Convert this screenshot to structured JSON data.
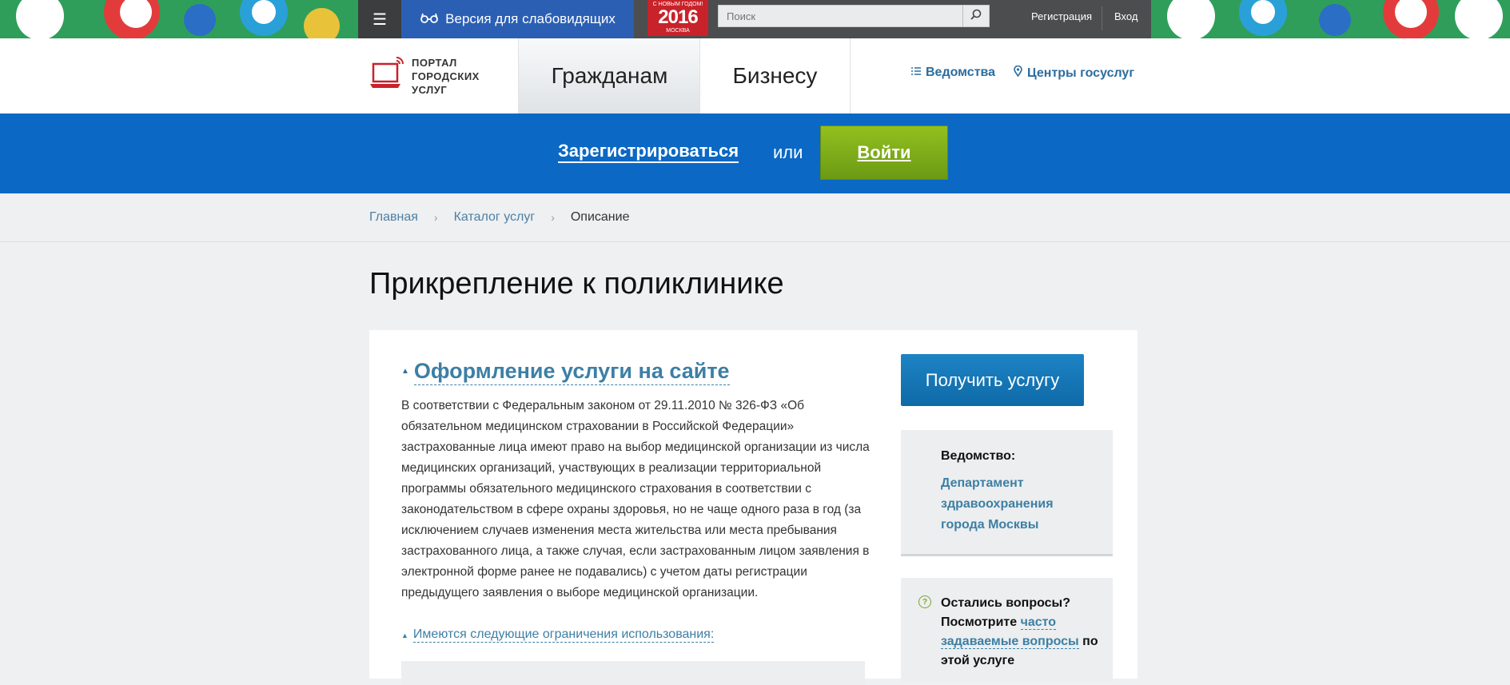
{
  "topbar": {
    "vision_label": "Версия для слабовидящих",
    "ny_badge": {
      "line1": "С НОВЫМ ГОДОМ!",
      "year": "2016",
      "line3": "МОСКВА"
    },
    "search_placeholder": "Поиск",
    "register_label": "Регистрация",
    "login_label": "Вход"
  },
  "header": {
    "logo_lines": [
      "ПОРТАЛ",
      "ГОРОДСКИХ",
      "УСЛУГ"
    ],
    "tabs": [
      {
        "label": "Гражданам"
      },
      {
        "label": "Бизнесу"
      }
    ],
    "links": [
      {
        "label": "Ведомства"
      },
      {
        "label": "Центры госуслуг"
      }
    ]
  },
  "band": {
    "register_label": "Зарегистрироваться",
    "or_label": "или",
    "login_label": "Войти"
  },
  "breadcrumbs": [
    {
      "label": "Главная"
    },
    {
      "label": "Каталог услуг"
    },
    {
      "label": "Описание"
    }
  ],
  "page": {
    "title": "Прикрепление к поликлинике",
    "section_title": "Оформление услуги на сайте",
    "paragraph": "В соответствии с Федеральным законом от 29.11.2010 № 326-ФЗ «Об обязательном медицинском страховании в Российской Федерации» застрахованные лица имеют право на выбор медицинской организации из числа медицинских организаций, участвующих в реализации территориальной программы обязательного медицинского страхования в соответствии с законодательством в сфере охраны здоровья, но не чаще одного раза в год (за исключением случаев изменения места жительства или места пребывания застрахованного лица, а также случая, если застрахованным лицом заявления в электронной форме ранее не подавались) с учетом даты регистрации предыдущего заявления о выборе медицинской организации.",
    "restrictions_toggle": "Имеются следующие ограничения использования:"
  },
  "sidebar": {
    "get_service_label": "Получить услугу",
    "dept_label": "Ведомство:",
    "dept_value": "Департамент здравоохранения города Москвы",
    "questions_prefix": "Остались вопросы? Посмотрите ",
    "faq_link": "часто задаваемые вопросы",
    "questions_suffix": " по этой услуге"
  },
  "colors": {
    "topbar": "#4b4d4f",
    "accent_blue": "#0b68c4",
    "login_green": "#7aab1a",
    "link_blue": "#3d7fa5"
  }
}
